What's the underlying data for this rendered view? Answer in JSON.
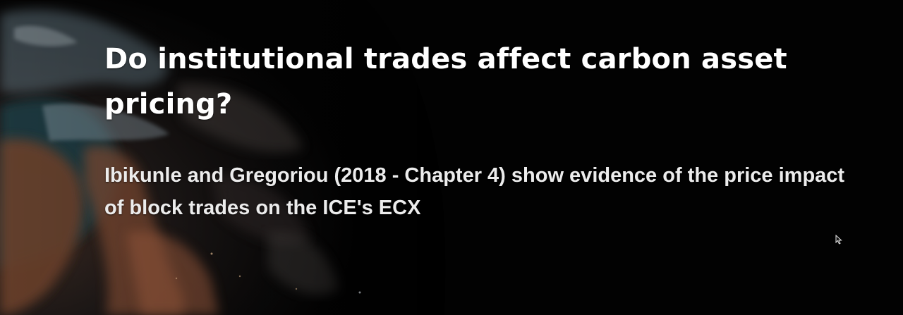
{
  "slide": {
    "title": "Do institutional trades affect carbon asset pricing?",
    "body": "Ibikunle and Gregoriou (2018 - Chapter 4) show evidence of the price impact of block trades on the ICE's ECX"
  },
  "background": {
    "image": "earth-from-space",
    "space_color": "#020202"
  },
  "cursor": {
    "icon": "mouse-pointer-icon"
  }
}
